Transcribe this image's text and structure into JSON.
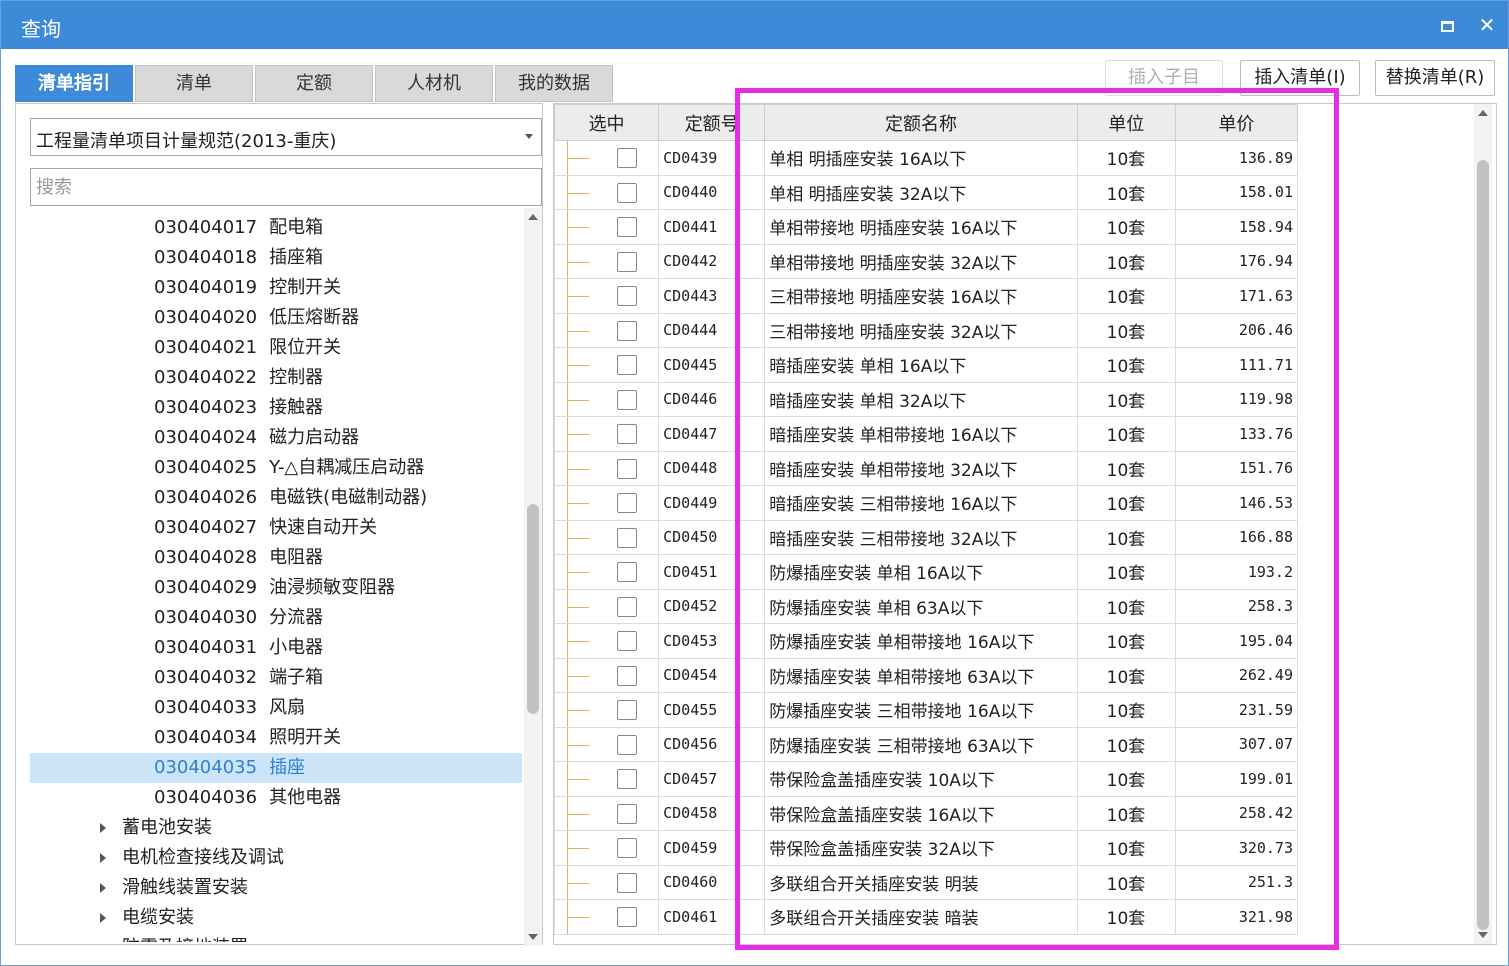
{
  "window": {
    "title": "查询",
    "accent": "#3c8ad8",
    "highlight_color": "#e62de6"
  },
  "tabs": [
    "清单指引",
    "清单",
    "定额",
    "人材机",
    "我的数据"
  ],
  "toolbar": {
    "insert_child": "插入子目",
    "insert_list": "插入清单(I)",
    "replace_list": "替换清单(R)"
  },
  "left": {
    "spec_select": "工程量清单项目计量规范(2013-重庆)",
    "search_placeholder": "搜索",
    "tree": [
      {
        "code": "030404017",
        "name": "配电箱"
      },
      {
        "code": "030404018",
        "name": "插座箱"
      },
      {
        "code": "030404019",
        "name": "控制开关"
      },
      {
        "code": "030404020",
        "name": "低压熔断器"
      },
      {
        "code": "030404021",
        "name": "限位开关"
      },
      {
        "code": "030404022",
        "name": "控制器"
      },
      {
        "code": "030404023",
        "name": "接触器"
      },
      {
        "code": "030404024",
        "name": "磁力启动器"
      },
      {
        "code": "030404025",
        "name": "Y-△自耦减压启动器"
      },
      {
        "code": "030404026",
        "name": "电磁铁(电磁制动器)"
      },
      {
        "code": "030404027",
        "name": "快速自动开关"
      },
      {
        "code": "030404028",
        "name": "电阻器"
      },
      {
        "code": "030404029",
        "name": "油浸频敏变阻器"
      },
      {
        "code": "030404030",
        "name": "分流器"
      },
      {
        "code": "030404031",
        "name": "小电器"
      },
      {
        "code": "030404032",
        "name": "端子箱"
      },
      {
        "code": "030404033",
        "name": "风扇"
      },
      {
        "code": "030404034",
        "name": "照明开关"
      },
      {
        "code": "030404035",
        "name": "插座"
      },
      {
        "code": "030404036",
        "name": "其他电器"
      }
    ],
    "selected_index": 18,
    "groups": [
      "蓄电池安装",
      "电机检查接线及调试",
      "滑触线装置安装",
      "电缆安装",
      "防雷及接地装置"
    ]
  },
  "grid": {
    "headers": [
      "选中",
      "定额号",
      "定额名称",
      "单位",
      "单价"
    ],
    "rows": [
      [
        "CD0439",
        "单相 明插座安装 16A以下",
        "10套",
        "136.89"
      ],
      [
        "CD0440",
        "单相 明插座安装 32A以下",
        "10套",
        "158.01"
      ],
      [
        "CD0441",
        "单相带接地 明插座安装 16A以下",
        "10套",
        "158.94"
      ],
      [
        "CD0442",
        "单相带接地 明插座安装 32A以下",
        "10套",
        "176.94"
      ],
      [
        "CD0443",
        "三相带接地 明插座安装 16A以下",
        "10套",
        "171.63"
      ],
      [
        "CD0444",
        "三相带接地 明插座安装 32A以下",
        "10套",
        "206.46"
      ],
      [
        "CD0445",
        "暗插座安装 单相 16A以下",
        "10套",
        "111.71"
      ],
      [
        "CD0446",
        "暗插座安装 单相 32A以下",
        "10套",
        "119.98"
      ],
      [
        "CD0447",
        "暗插座安装 单相带接地 16A以下",
        "10套",
        "133.76"
      ],
      [
        "CD0448",
        "暗插座安装 单相带接地 32A以下",
        "10套",
        "151.76"
      ],
      [
        "CD0449",
        "暗插座安装 三相带接地 16A以下",
        "10套",
        "146.53"
      ],
      [
        "CD0450",
        "暗插座安装 三相带接地 32A以下",
        "10套",
        "166.88"
      ],
      [
        "CD0451",
        "防爆插座安装 单相 16A以下",
        "10套",
        "193.2"
      ],
      [
        "CD0452",
        "防爆插座安装 单相 63A以下",
        "10套",
        "258.3"
      ],
      [
        "CD0453",
        "防爆插座安装 单相带接地 16A以下",
        "10套",
        "195.04"
      ],
      [
        "CD0454",
        "防爆插座安装 单相带接地 63A以下",
        "10套",
        "262.49"
      ],
      [
        "CD0455",
        "防爆插座安装 三相带接地 16A以下",
        "10套",
        "231.59"
      ],
      [
        "CD0456",
        "防爆插座安装 三相带接地 63A以下",
        "10套",
        "307.07"
      ],
      [
        "CD0457",
        "带保险盒盖插座安装 10A以下",
        "10套",
        "199.01"
      ],
      [
        "CD0458",
        "带保险盒盖插座安装 16A以下",
        "10套",
        "258.42"
      ],
      [
        "CD0459",
        "带保险盒盖插座安装 32A以下",
        "10套",
        "320.73"
      ],
      [
        "CD0460",
        "多联组合开关插座安装 明装",
        "10套",
        "251.3"
      ],
      [
        "CD0461",
        "多联组合开关插座安装 暗装",
        "10套",
        "321.98"
      ]
    ]
  }
}
